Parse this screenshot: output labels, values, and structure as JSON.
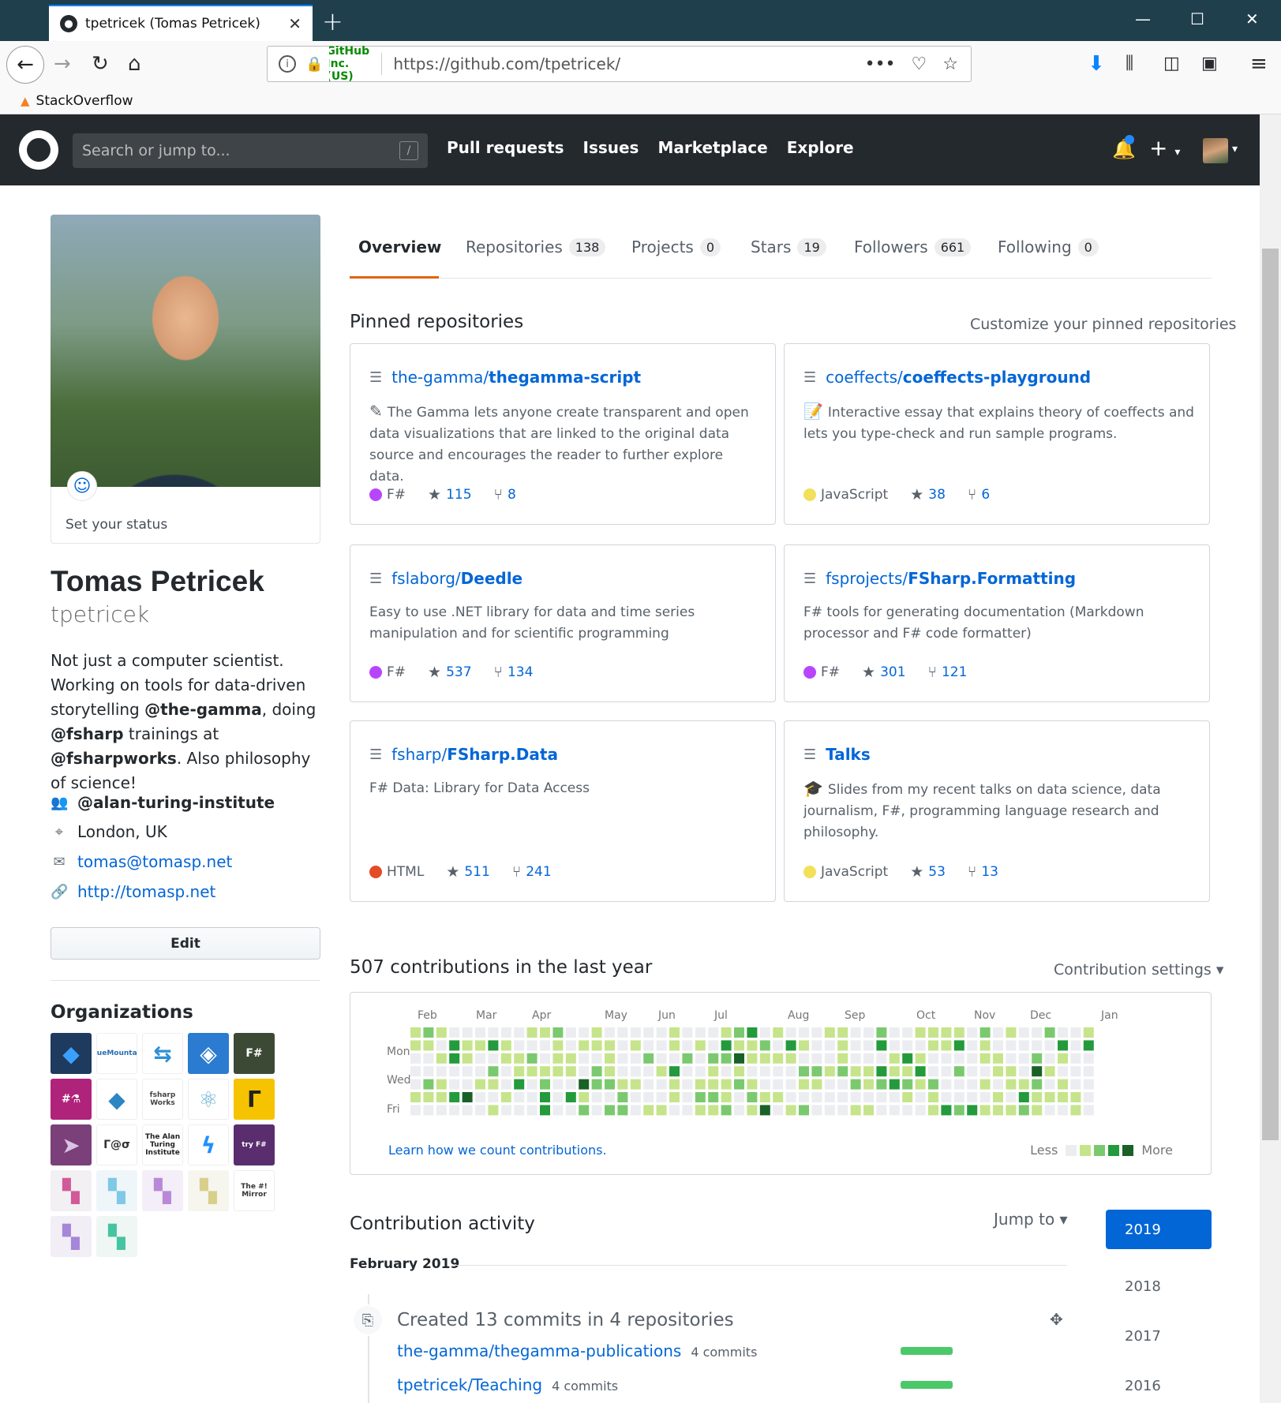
{
  "browser": {
    "tab_title": "tpetricek (Tomas Petricek)",
    "url_org": "GitHub, Inc. (US)",
    "url": "https://github.com/tpetricek/",
    "bookmark": "StackOverflow"
  },
  "gh": {
    "search_placeholder": "Search or jump to...",
    "search_key": "/",
    "nav": [
      "Pull requests",
      "Issues",
      "Marketplace",
      "Explore"
    ]
  },
  "profile": {
    "status": "Set your status",
    "name": "Tomas Petricek",
    "login": "tpetricek",
    "bio_parts": [
      "Not just a computer scientist. Working on tools for data-driven storytelling ",
      "@the-gamma",
      ", doing ",
      "@fsharp",
      " trainings at ",
      "@fsharpworks",
      ". Also philosophy of science!"
    ],
    "org": "@alan-turing-institute",
    "location": "London, UK",
    "email": "tomas@tomasp.net",
    "website": "http://tomasp.net",
    "edit": "Edit",
    "orgs_title": "Organizations"
  },
  "orgs": [
    {
      "label": "◆",
      "bg": "#1e3a5f",
      "fg": "#3aa0ff"
    },
    {
      "label": "BlueMountain",
      "bg": "#ffffff",
      "fg": "#2a6fb0"
    },
    {
      "label": "⇆",
      "bg": "#ffffff",
      "fg": "#2d8fd5"
    },
    {
      "label": "◈",
      "bg": "#2b7bd0",
      "fg": "#ffffff"
    },
    {
      "label": "F#",
      "bg": "#3c4a35",
      "fg": "#ffffff"
    },
    {
      "label": "#⚗",
      "bg": "#b0237b",
      "fg": "#ffffff"
    },
    {
      "label": "◆",
      "bg": "#ffffff",
      "fg": "#2d86c4"
    },
    {
      "label": "fsharp Works",
      "bg": "#ffffff",
      "fg": "#444444"
    },
    {
      "label": "⚛",
      "bg": "#ffffff",
      "fg": "#6ab0d0"
    },
    {
      "label": "Γ",
      "bg": "#f5c300",
      "fg": "#222222"
    },
    {
      "label": "➤",
      "bg": "#7b3f7a",
      "fg": "#d9c4e3"
    },
    {
      "label": "Γ@σ",
      "bg": "#ffffff",
      "fg": "#333333"
    },
    {
      "label": "The Alan Turing Institute",
      "bg": "#ffffff",
      "fg": "#222222"
    },
    {
      "label": "ϟ",
      "bg": "#ffffff",
      "fg": "#1e90ff"
    },
    {
      "label": "try F#",
      "bg": "#5a2d6e",
      "fg": "#ffffff"
    },
    {
      "label": "▚",
      "bg": "#f2f0f2",
      "fg": "#d25a98"
    },
    {
      "label": "▚",
      "bg": "#eef6fa",
      "fg": "#7fc8e6"
    },
    {
      "label": "▚",
      "bg": "#f3eef7",
      "fg": "#b988d8"
    },
    {
      "label": "▚",
      "bg": "#f6f5ee",
      "fg": "#d8d08a"
    },
    {
      "label": "The #! Mirror",
      "bg": "#ffffff",
      "fg": "#333333"
    },
    {
      "label": "▚",
      "bg": "#f1eef6",
      "fg": "#a586d8"
    },
    {
      "label": "▚",
      "bg": "#eef7f4",
      "fg": "#44c4a0"
    }
  ],
  "tabs": [
    {
      "label": "Overview",
      "count": ""
    },
    {
      "label": "Repositories",
      "count": "138"
    },
    {
      "label": "Projects",
      "count": "0"
    },
    {
      "label": "Stars",
      "count": "19"
    },
    {
      "label": "Followers",
      "count": "661"
    },
    {
      "label": "Following",
      "count": "0"
    }
  ],
  "pinned": {
    "title": "Pinned repositories",
    "customize": "Customize your pinned repositories",
    "repos": [
      {
        "owner": "the-gamma/",
        "repo": "thegamma-script",
        "emoji": "✎",
        "desc": "The Gamma lets anyone create transparent and open data visualizations that are linked to the original data source and encourages the reader to further explore data.",
        "lang": "F#",
        "lang_color": "#b845fc",
        "stars": "115",
        "forks": "8"
      },
      {
        "owner": "coeffects/",
        "repo": "coeffects-playground",
        "emoji": "📝",
        "desc": "Interactive essay that explains theory of coeffects and lets you type-check and run sample programs.",
        "lang": "JavaScript",
        "lang_color": "#f1e05a",
        "stars": "38",
        "forks": "6"
      },
      {
        "owner": "fslaborg/",
        "repo": "Deedle",
        "emoji": "",
        "desc": "Easy to use .NET library for data and time series manipulation and for scientific programming",
        "lang": "F#",
        "lang_color": "#b845fc",
        "stars": "537",
        "forks": "134"
      },
      {
        "owner": "fsprojects/",
        "repo": "FSharp.Formatting",
        "emoji": "",
        "desc": "F# tools for generating documentation (Markdown processor and F# code formatter)",
        "lang": "F#",
        "lang_color": "#b845fc",
        "stars": "301",
        "forks": "121"
      },
      {
        "owner": "fsharp/",
        "repo": "FSharp.Data",
        "emoji": "",
        "desc": "F# Data: Library for Data Access",
        "lang": "HTML",
        "lang_color": "#e34c26",
        "stars": "511",
        "forks": "241"
      },
      {
        "owner": "",
        "repo": "Talks",
        "emoji": "🎓",
        "desc": "Slides from my recent talks on data science, data journalism, F#, programming language research and philosophy.",
        "lang": "JavaScript",
        "lang_color": "#f1e05a",
        "stars": "53",
        "forks": "13"
      }
    ]
  },
  "contrib": {
    "title": "507 contributions in the last year",
    "settings": "Contribution settings ▾",
    "months": [
      "Feb",
      "Mar",
      "Apr",
      "May",
      "Jun",
      "Jul",
      "Aug",
      "Sep",
      "Oct",
      "Nov",
      "Dec",
      "Jan"
    ],
    "days": [
      "Mon",
      "Wed",
      "Fri"
    ],
    "learn": "Learn how we count contributions.",
    "less": "Less",
    "more": "More",
    "colors": [
      "#ebedf0",
      "#c6e48b",
      "#7bc96f",
      "#239a3b",
      "#196127"
    ]
  },
  "activity": {
    "title": "Contribution activity",
    "jump": "Jump to ▾",
    "years": [
      "2019",
      "2018",
      "2017",
      "2016"
    ],
    "month": "February 2019",
    "summary": "Created 13 commits in 4 repositories",
    "rows": [
      {
        "repo": "the-gamma/thegamma-publications",
        "commits": "4 commits"
      },
      {
        "repo": "tpetricek/Teaching",
        "commits": "4 commits"
      }
    ]
  }
}
